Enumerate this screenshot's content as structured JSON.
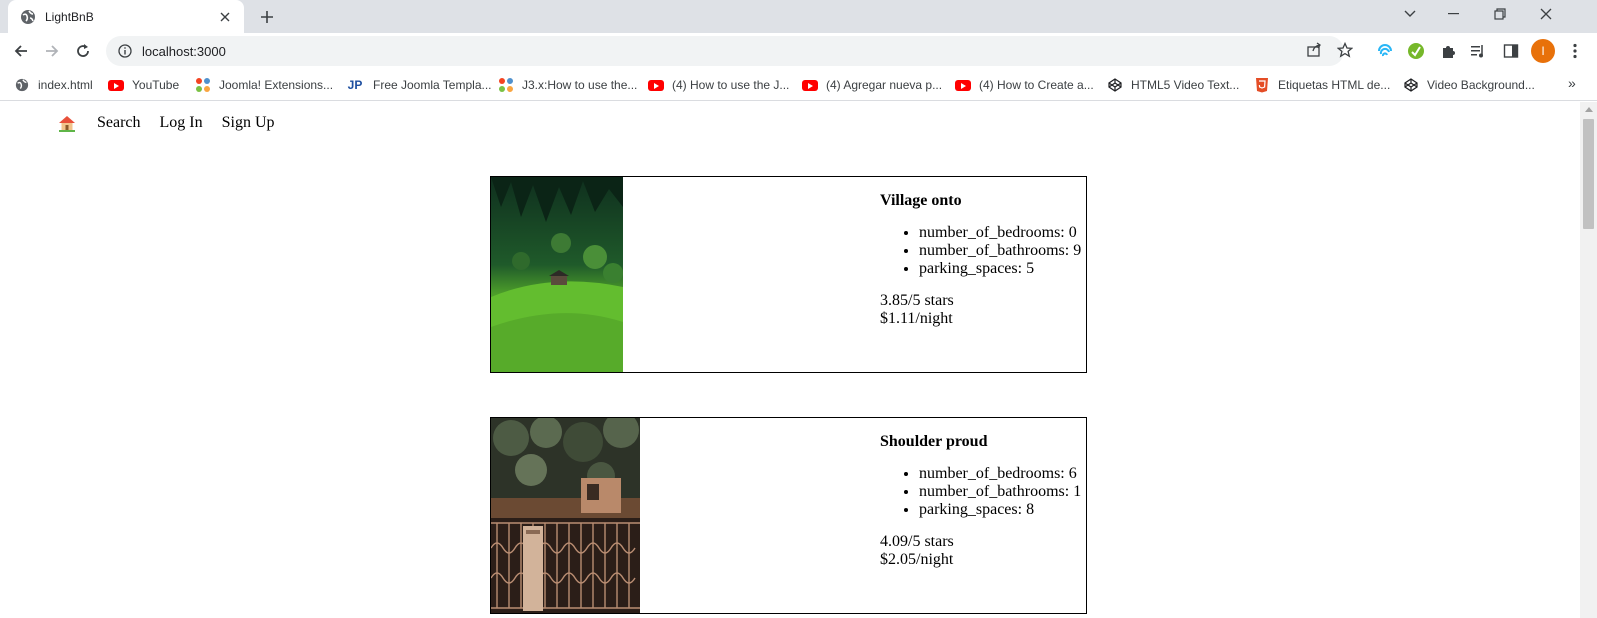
{
  "browser": {
    "tab_title": "LightBnB",
    "url": "localhost:3000",
    "avatar_initial": "I",
    "bookmarks": [
      {
        "label": "index.html",
        "icon": "globe-icon"
      },
      {
        "label": "YouTube",
        "icon": "youtube-icon"
      },
      {
        "label": "Joomla! Extensions...",
        "icon": "joomla-icon"
      },
      {
        "label": "Free Joomla Templa...",
        "icon": "jp-icon"
      },
      {
        "label": "J3.x:How to use the...",
        "icon": "joomla-icon"
      },
      {
        "label": "(4) How to use the J...",
        "icon": "youtube-icon"
      },
      {
        "label": "(4) Agregar nueva p...",
        "icon": "youtube-icon"
      },
      {
        "label": "(4) How to Create a...",
        "icon": "youtube-icon"
      },
      {
        "label": "HTML5 Video Text...",
        "icon": "codepen-icon"
      },
      {
        "label": "Etiquetas HTML de...",
        "icon": "html5-icon"
      },
      {
        "label": "Video Background...",
        "icon": "codepen-icon"
      }
    ]
  },
  "site_nav": {
    "home_icon": "house-icon",
    "search": "Search",
    "login": "Log In",
    "signup": "Sign Up"
  },
  "listings": [
    {
      "title": "Village onto",
      "bedrooms": "number_of_bedrooms: 0",
      "bathrooms": "number_of_bathrooms: 9",
      "parking": "parking_spaces: 5",
      "rating": "3.85/5 stars",
      "price": "$1.11/night"
    },
    {
      "title": "Shoulder proud",
      "bedrooms": "number_of_bedrooms: 6",
      "bathrooms": "number_of_bathrooms: 1",
      "parking": "parking_spaces: 8",
      "rating": "4.09/5 stars",
      "price": "$2.05/night"
    }
  ]
}
